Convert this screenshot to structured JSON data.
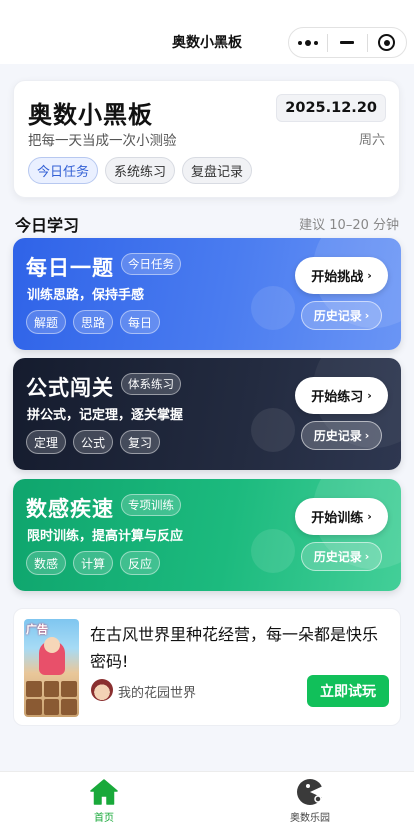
{
  "navbar": {
    "title": "奥数小黑板",
    "capsule": {
      "more_icon": "more-dots-icon",
      "minimize_icon": "minimize-icon",
      "close_icon": "target-circle-icon"
    }
  },
  "header": {
    "title": "奥数小黑板",
    "subtitle": "把每一天当成一次小测验",
    "date": "2025.12.20",
    "weekday": "周六",
    "chips": [
      "今日任务",
      "系统练习",
      "复盘记录"
    ],
    "active_chip": "今日任务"
  },
  "section": {
    "title": "今日学习",
    "hint": "建议 10–20 分钟"
  },
  "modules": [
    {
      "title": "每日一题",
      "tag": "今日任务",
      "desc": "训练思路，保持手感",
      "chips": [
        "解题",
        "思路",
        "每日"
      ],
      "primary": "开始挑战",
      "secondary": "历史记录",
      "color": "#3a6cec"
    },
    {
      "title": "公式闯关",
      "tag": "体系练习",
      "desc": "拼公式，记定理，逐关掌握",
      "chips": [
        "定理",
        "公式",
        "复习"
      ],
      "primary": "开始练习",
      "secondary": "历史记录",
      "color": "#1b2236"
    },
    {
      "title": "数感疾速",
      "tag": "专项训练",
      "desc": "限时训练，提高计算与反应",
      "chips": [
        "数感",
        "计算",
        "反应"
      ],
      "primary": "开始训练",
      "secondary": "历史记录",
      "color": "#16b075"
    }
  ],
  "ad": {
    "badge": "广告",
    "text": "在古风世界里种花经营，每一朵都是快乐密码!",
    "app_name": "我的花园世界",
    "button": "立即试玩",
    "button_color": "#11c05a"
  },
  "tabbar": {
    "items": [
      {
        "label": "首页",
        "icon": "home-icon",
        "active": true
      },
      {
        "label": "奥数乐园",
        "icon": "pacman-icon",
        "active": false
      }
    ],
    "active_color": "#19a93a"
  }
}
